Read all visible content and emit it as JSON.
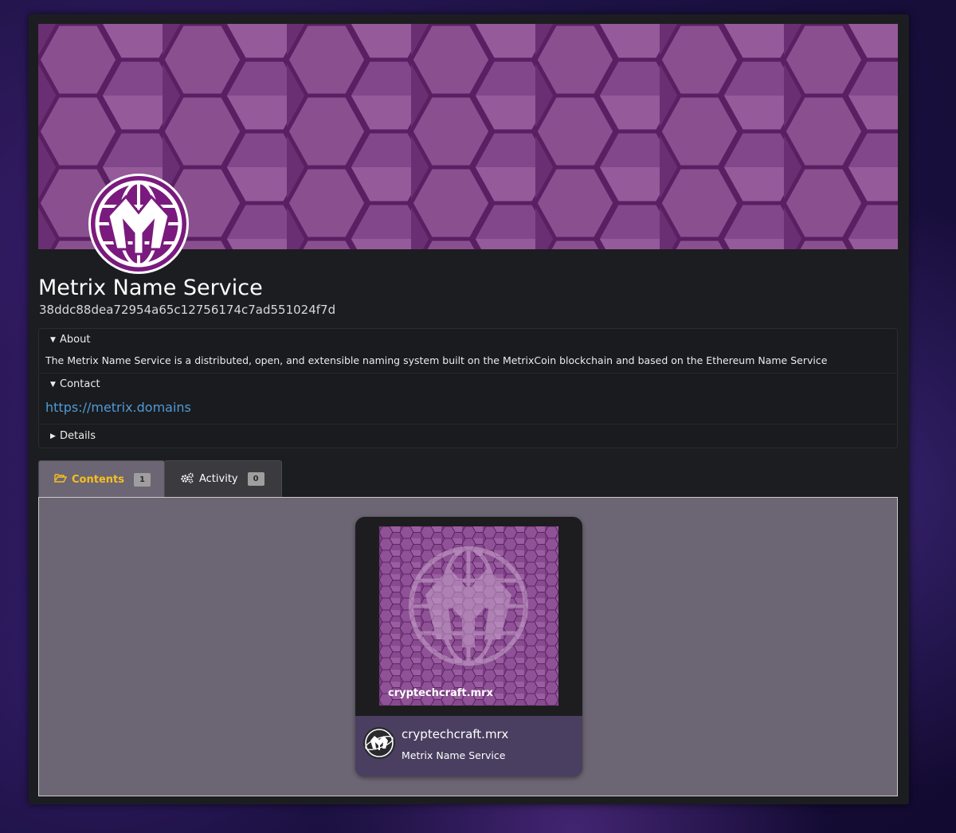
{
  "collection": {
    "title": "Metrix Name Service",
    "address": "38ddc88dea72954a65c12756174c7ad551024f7d"
  },
  "accordion": {
    "about_label": "About",
    "about_text": "The Metrix Name Service is a distributed, open, and extensible naming system built on the MetrixCoin blockchain and based on the Ethereum Name Service",
    "contact_label": "Contact",
    "contact_link": "https://metrix.domains",
    "details_label": "Details"
  },
  "tabs": [
    {
      "label": "Contents",
      "count": "1",
      "icon": "folder-open-icon",
      "active": true
    },
    {
      "label": "Activity",
      "count": "0",
      "icon": "gears-icon",
      "active": false
    }
  ],
  "items": [
    {
      "image_label": "cryptechcraft.mrx",
      "name": "cryptechcraft.mrx",
      "collection": "Metrix Name Service"
    }
  ],
  "colors": {
    "accent_active_tab": "#f5c020",
    "link": "#4f9ad8",
    "banner_purple": "#7e3f85",
    "logo_purple": "#7a1a7e",
    "pane_bg": "#6c6573",
    "card_footer": "#4a3f60"
  }
}
